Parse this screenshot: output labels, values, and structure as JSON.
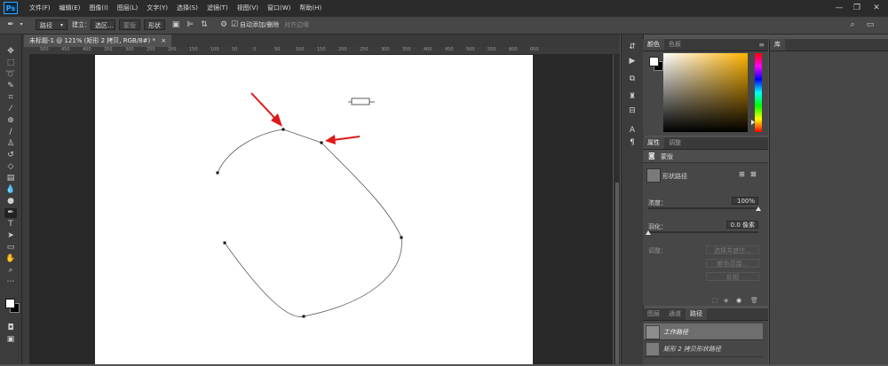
{
  "app": {
    "logo": "Ps"
  },
  "menu": [
    "文件(F)",
    "编辑(E)",
    "图像(I)",
    "图层(L)",
    "文字(Y)",
    "选择(S)",
    "滤镜(T)",
    "视图(V)",
    "窗口(W)",
    "帮助(H)"
  ],
  "window_controls": {
    "minimize": "—",
    "restore": "❐",
    "close": "✕"
  },
  "options_bar": {
    "mode_value": "路径",
    "build_label": "建立：",
    "selection_button": "选区...",
    "mask_button": "蒙版",
    "shape_button": "形状",
    "auto_add_delete_label": "自动添加/删除",
    "align_edges_label": "对齐边缘"
  },
  "document": {
    "tab_title": "未标题-1 @ 121% (矩形 2 拷贝, RGB/8#) *",
    "tab_close": "×",
    "ruler_labels": [
      "500",
      "450",
      "400",
      "350",
      "300",
      "250",
      "200",
      "150",
      "100",
      "50",
      "0",
      "50",
      "100",
      "150",
      "200",
      "250",
      "300",
      "350",
      "400",
      "450",
      "500",
      "550",
      "600",
      "650"
    ]
  },
  "color_panel": {
    "tabs": [
      "颜色",
      "色板"
    ],
    "menu": "≡",
    "foreground": "#ffffff",
    "background": "#000000",
    "hue_color": "#ffb300"
  },
  "properties_panel": {
    "tabs": [
      "属性",
      "调整"
    ],
    "section_title": "蒙版",
    "mask_label": "形状路径",
    "density_label": "浓度：",
    "density_value": "100%",
    "density_fraction": 1.0,
    "feather_label": "羽化：",
    "feather_value": "0.0 像素",
    "feather_fraction": 0.0,
    "refine_label": "调整：",
    "select_mask_button": "选择并遮住...",
    "color_range_button": "颜色范围...",
    "invert_button": "反相"
  },
  "paths_panel": {
    "tabs": [
      "图层",
      "通道",
      "路径"
    ],
    "items": [
      "工作路径",
      "矩形 2 拷贝形状路径"
    ]
  },
  "library_panel": {
    "title": "库"
  }
}
